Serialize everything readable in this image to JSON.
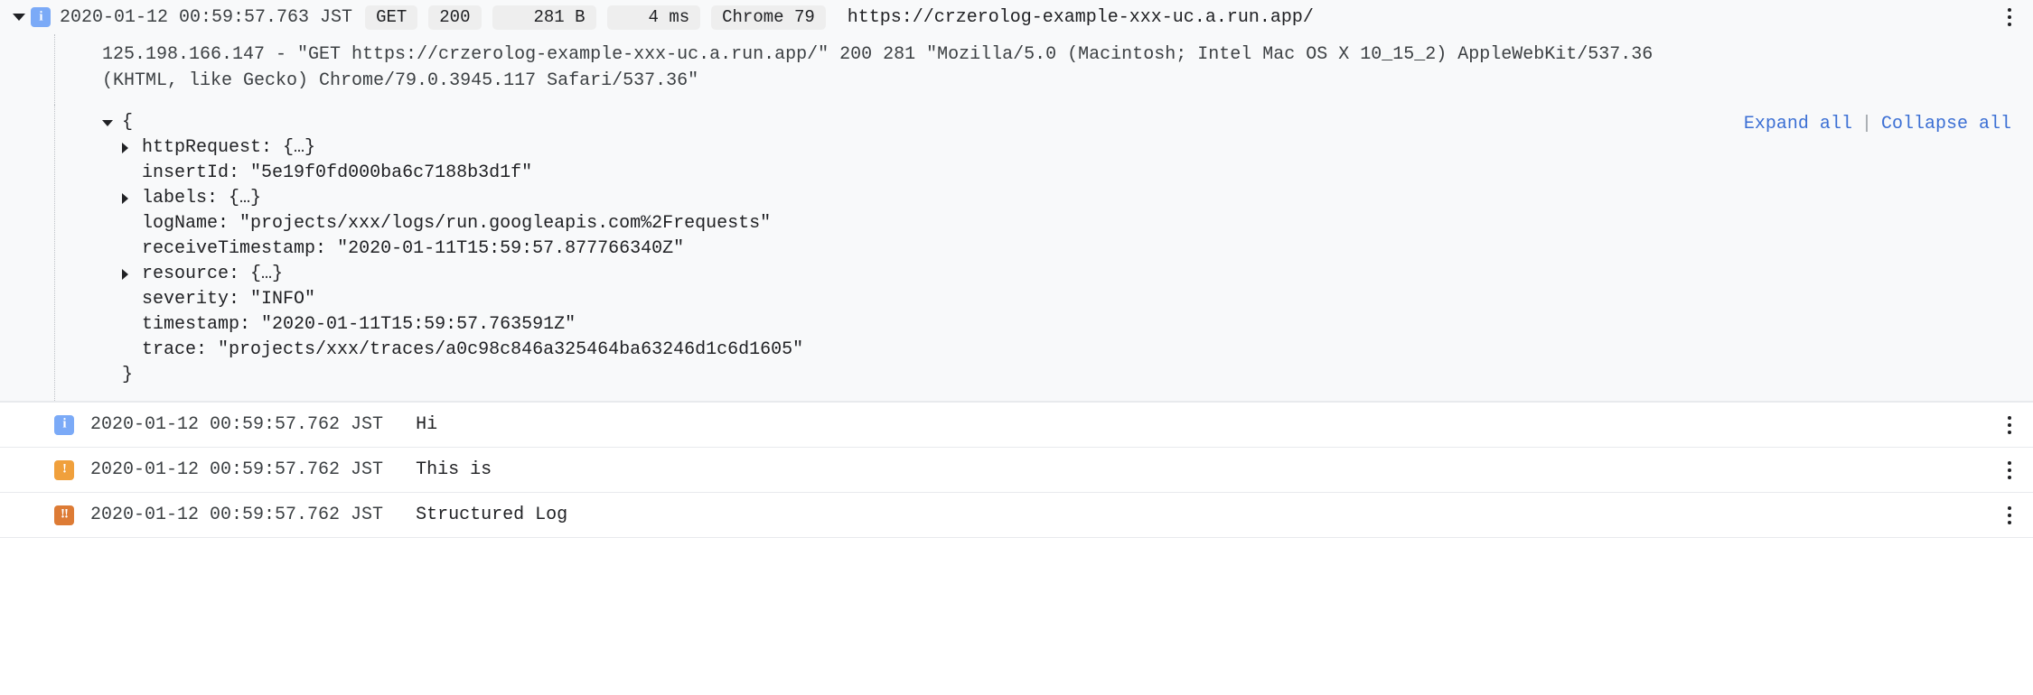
{
  "expanded_entry": {
    "twisty_state": "expanded",
    "severity_icon": "info-icon",
    "severity_glyph": "i",
    "timestamp": "2020-01-12 00:59:57.763 JST",
    "chips": {
      "method": "GET",
      "status": "200",
      "size": "281 B",
      "latency": "4 ms",
      "user_agent": "Chrome 79"
    },
    "url": "https://crzerolog-example-xxx-uc.a.run.app/",
    "overflow_menu": "more-options",
    "payload_lines": [
      "125.198.166.147 - \"GET https://crzerolog-example-xxx-uc.a.run.app/\" 200 281 \"Mozilla/5.0 (Macintosh; Intel Mac OS X 10_15_2) AppleWebKit/537.36",
      "(KHTML, like Gecko) Chrome/79.0.3945.117 Safari/537.36\""
    ],
    "tree_actions": {
      "expand_all": "Expand all",
      "divider": "|",
      "collapse_all": "Collapse all"
    },
    "json_tree": {
      "open_brace": "{",
      "close_brace": "}",
      "fields": [
        {
          "expandable": true,
          "key": "httpRequest:",
          "value": "{…}"
        },
        {
          "expandable": false,
          "key": "insertId:",
          "value": "\"5e19f0fd000ba6c7188b3d1f\""
        },
        {
          "expandable": true,
          "key": "labels:",
          "value": "{…}"
        },
        {
          "expandable": false,
          "key": "logName:",
          "value": "\"projects/xxx/logs/run.googleapis.com%2Frequests\""
        },
        {
          "expandable": false,
          "key": "receiveTimestamp:",
          "value": "\"2020-01-11T15:59:57.877766340Z\""
        },
        {
          "expandable": true,
          "key": "resource:",
          "value": "{…}"
        },
        {
          "expandable": false,
          "key": "severity:",
          "value": "\"INFO\""
        },
        {
          "expandable": false,
          "key": "timestamp:",
          "value": "\"2020-01-11T15:59:57.763591Z\""
        },
        {
          "expandable": false,
          "key": "trace:",
          "value": "\"projects/xxx/traces/a0c98c846a325464ba63246d1c6d1605\""
        }
      ]
    }
  },
  "log_rows": [
    {
      "severity": "INFO",
      "severity_icon": "info-icon",
      "severity_glyph": "i",
      "timestamp": "2020-01-12 00:59:57.762 JST",
      "message": "Hi",
      "overflow_menu": "more-options"
    },
    {
      "severity": "WARNING",
      "severity_icon": "warning-icon",
      "severity_glyph": "!",
      "timestamp": "2020-01-12 00:59:57.762 JST",
      "message": "This is",
      "overflow_menu": "more-options"
    },
    {
      "severity": "ERROR",
      "severity_icon": "error-icon",
      "severity_glyph": "!!",
      "timestamp": "2020-01-12 00:59:57.762 JST",
      "message": "Structured Log",
      "overflow_menu": "more-options"
    }
  ],
  "colors": {
    "info": "#7baaf7",
    "warning": "#f0a03c",
    "error": "#dd7b35",
    "link": "#3b6fd4",
    "chip_bg": "#eeeeee",
    "expanded_bg": "#f8f9fa"
  }
}
